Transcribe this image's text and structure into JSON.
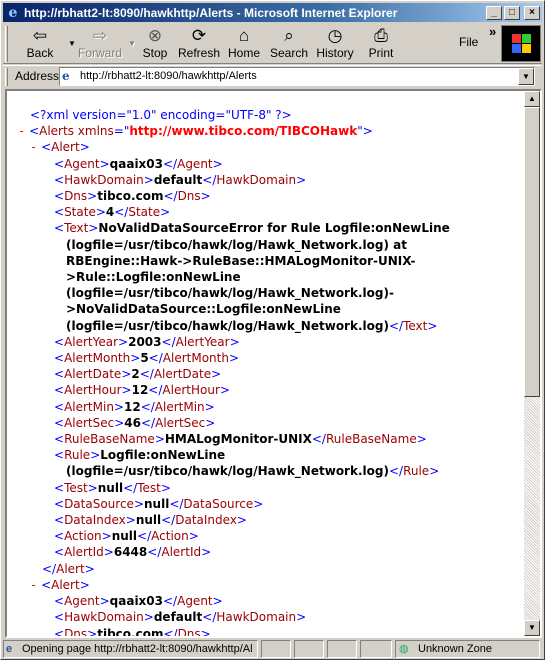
{
  "window": {
    "title": "http://rbhatt2-lt:8090/hawkhttp/Alerts - Microsoft Internet Explorer"
  },
  "toolbar": {
    "back_label": "Back",
    "forward_label": "Forward",
    "stop_label": "Stop",
    "refresh_label": "Refresh",
    "home_label": "Home",
    "search_label": "Search",
    "history_label": "History",
    "print_label": "Print",
    "file_label": "File",
    "more_chevron": "»"
  },
  "address": {
    "label": "Address",
    "value": "http://rbhatt2-lt:8090/hawkhttp/Alerts"
  },
  "xml": {
    "declaration": "<?xml version=\"1.0\" encoding=\"UTF-8\" ?>",
    "root_tag": "Alerts",
    "root_attr": "xmlns",
    "root_attr_value": "http://www.tibco.com/TIBCOHawk",
    "alert_tag": "Alert",
    "collapse_marker": "-",
    "alert1": {
      "Agent": "qaaix03",
      "HawkDomain": "default",
      "Dns": "tibco.com",
      "State": "4",
      "Text": [
        "NoValidDataSourceError for Rule Logfile:onNewLine",
        "(logfile=/usr/tibco/hawk/log/Hawk_Network.log) at",
        "RBEngine::Hawk->RuleBase::HMALogMonitor-UNIX-",
        ">Rule::Logfile:onNewLine",
        "(logfile=/usr/tibco/hawk/log/Hawk_Network.log)-",
        ">NoValidDataSource::Logfile:onNewLine",
        "(logfile=/usr/tibco/hawk/log/Hawk_Network.log)"
      ],
      "AlertYear": "2003",
      "AlertMonth": "5",
      "AlertDate": "2",
      "AlertHour": "12",
      "AlertMin": "12",
      "AlertSec": "46",
      "RuleBaseName": "HMALogMonitor-UNIX",
      "Rule": [
        "Logfile:onNewLine",
        "(logfile=/usr/tibco/hawk/log/Hawk_Network.log)"
      ],
      "Test": "null",
      "DataSource": "null",
      "DataIndex": "null",
      "Action": "null",
      "AlertId": "6448"
    },
    "alert2": {
      "Agent": "qaaix03",
      "HawkDomain": "default",
      "Dns": "tibco.com"
    }
  },
  "status": {
    "message": "Opening page http://rbhatt2-lt:8090/hawkhttp/Al",
    "zone": "Unknown Zone"
  },
  "colors": {
    "titlebar_start": "#0a246a",
    "tag": "#990000",
    "bracket": "#0000ff",
    "attr_value": "#ff0000"
  }
}
